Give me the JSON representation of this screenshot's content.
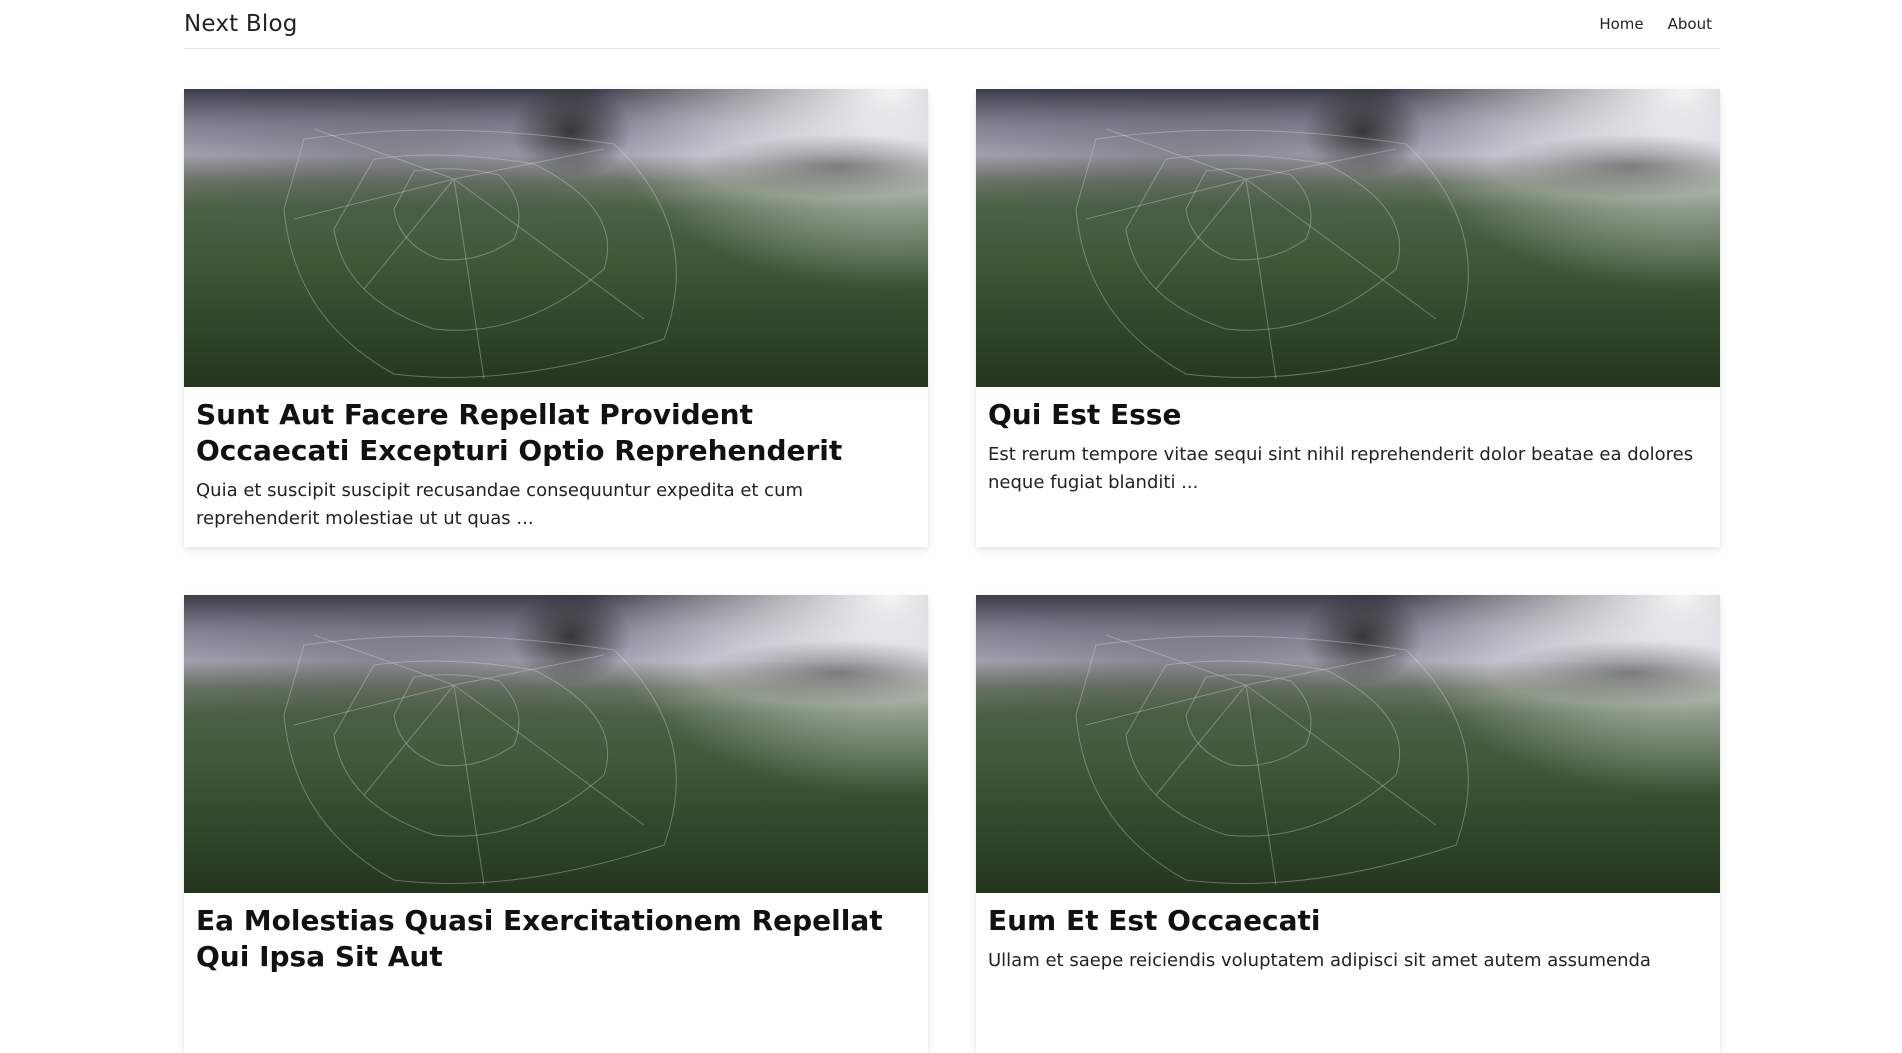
{
  "header": {
    "brand": "Next Blog",
    "nav": [
      {
        "label": "Home"
      },
      {
        "label": "About"
      }
    ]
  },
  "posts": [
    {
      "title": "Sunt Aut Facere Repellat Provident Occaecati Excepturi Optio Reprehenderit",
      "excerpt": "Quia et suscipit suscipit recusandae consequuntur expedita et cum reprehenderit molestiae ut ut quas ..."
    },
    {
      "title": "Qui Est Esse",
      "excerpt": "Est rerum tempore vitae sequi sint nihil reprehenderit dolor beatae ea dolores neque fugiat blanditi ..."
    },
    {
      "title": "Ea Molestias Quasi Exercitationem Repellat Qui Ipsa Sit Aut",
      "excerpt": ""
    },
    {
      "title": "Eum Et Est Occaecati",
      "excerpt": "Ullam et saepe reiciendis voluptatem adipisci sit amet autem assumenda"
    }
  ],
  "colors": {
    "background": "#ffffff",
    "text": "#111111",
    "divider": "#e6e6e6"
  }
}
